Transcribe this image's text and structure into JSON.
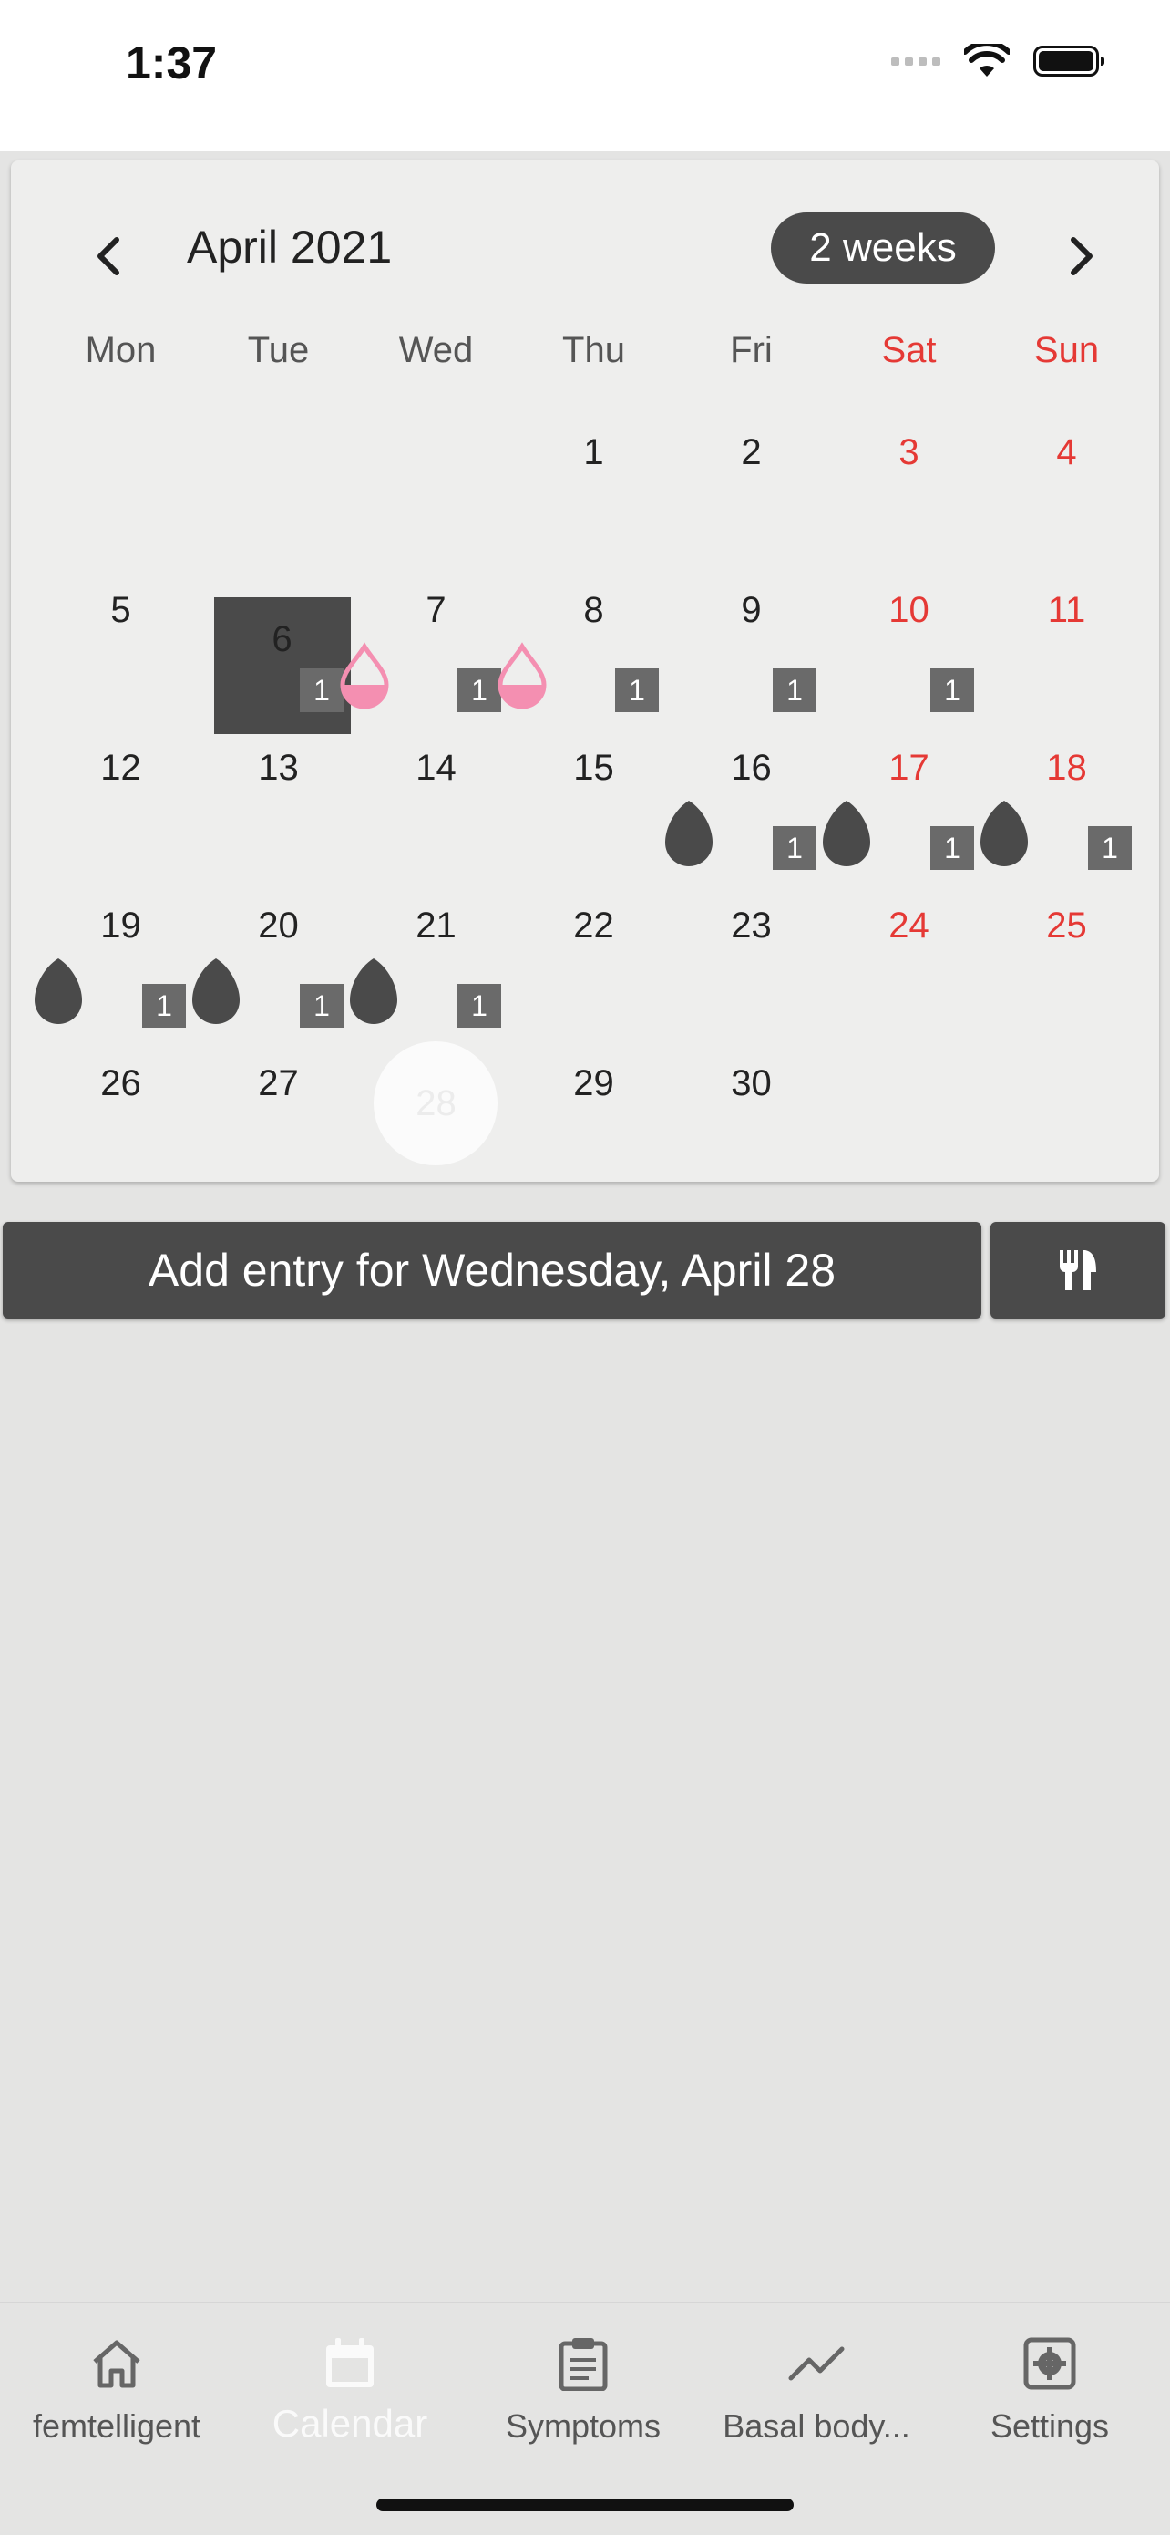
{
  "status_bar": {
    "time": "1:37"
  },
  "calendar": {
    "month_title": "April 2021",
    "range_toggle": "2 weeks",
    "weekdays": [
      "Mon",
      "Tue",
      "Wed",
      "Thu",
      "Fri",
      "Sat",
      "Sun"
    ],
    "weeks": [
      [
        null,
        null,
        null,
        {
          "day": "1"
        },
        {
          "day": "2"
        },
        {
          "day": "3"
        },
        {
          "day": "4"
        }
      ],
      [
        {
          "day": "5"
        },
        {
          "day": "6",
          "today": true,
          "count": "1"
        },
        {
          "day": "7",
          "marker": "light-flow",
          "count": "1"
        },
        {
          "day": "8",
          "marker": "light-flow",
          "count": "1"
        },
        {
          "day": "9",
          "count": "1"
        },
        {
          "day": "10",
          "count": "1"
        },
        {
          "day": "11"
        }
      ],
      [
        {
          "day": "12"
        },
        {
          "day": "13"
        },
        {
          "day": "14"
        },
        {
          "day": "15"
        },
        {
          "day": "16",
          "marker": "dark-drop",
          "count": "1"
        },
        {
          "day": "17",
          "marker": "dark-drop",
          "count": "1"
        },
        {
          "day": "18",
          "marker": "dark-drop",
          "count": "1"
        }
      ],
      [
        {
          "day": "19",
          "marker": "dark-drop",
          "count": "1"
        },
        {
          "day": "20",
          "marker": "dark-drop",
          "count": "1"
        },
        {
          "day": "21",
          "marker": "dark-drop",
          "count": "1"
        },
        {
          "day": "22"
        },
        {
          "day": "23"
        },
        {
          "day": "24"
        },
        {
          "day": "25"
        }
      ],
      [
        {
          "day": "26"
        },
        {
          "day": "27"
        },
        {
          "day": "28",
          "selected": true
        },
        {
          "day": "29"
        },
        {
          "day": "30"
        },
        null,
        null
      ]
    ],
    "colors": {
      "weekend": "#e53935",
      "flow": "#f48fb1",
      "drop": "#4a4a4a"
    }
  },
  "actions": {
    "add_entry_label": "Add entry for Wednesday, April 28",
    "meal_icon": "fork-knife-icon"
  },
  "bottom_nav": {
    "items": [
      {
        "label": "femtelligent",
        "icon": "home-icon"
      },
      {
        "label": "Calendar",
        "icon": "calendar-icon",
        "active": true
      },
      {
        "label": "Symptoms",
        "icon": "clipboard-icon"
      },
      {
        "label": "Basal body...",
        "icon": "trend-line-icon"
      },
      {
        "label": "Settings",
        "icon": "gear-icon"
      }
    ]
  }
}
